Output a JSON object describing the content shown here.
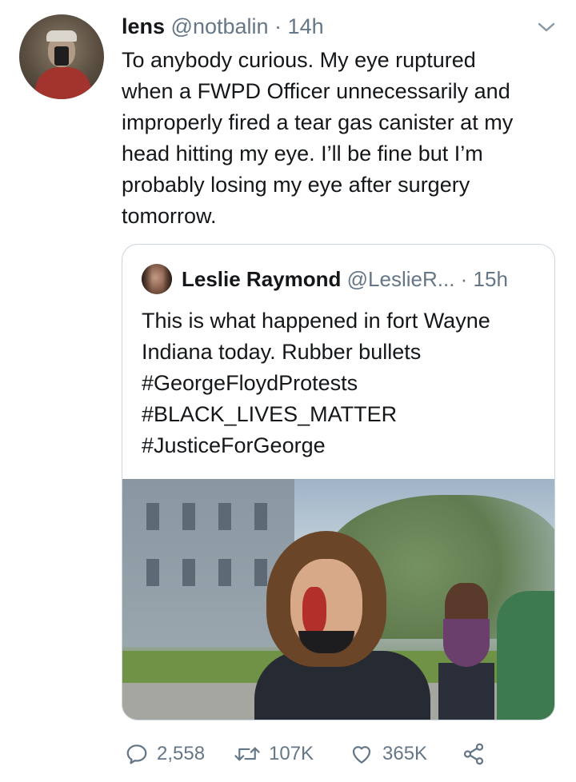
{
  "tweet": {
    "author_name": "lens",
    "author_handle": "@notbalin",
    "separator": " · ",
    "time": "14h",
    "text": "To anybody curious. My eye ruptured\nwhen a FWPD Officer unnecessarily and\nimproperly fired a tear gas canister at my\nhead hitting my eye. I’ll be fine but I’m\nprobably losing my eye after surgery\ntomorrow."
  },
  "quoted": {
    "author_name": "Leslie Raymond",
    "author_handle": "@LeslieR...",
    "separator": " · ",
    "time": "15h",
    "text": "This is what happened in fort Wayne\nIndiana today. Rubber bullets\n#GeorgeFloydProtests\n#BLACK_LIVES_MATTER\n#JusticeForGeorge"
  },
  "actions": {
    "replies": "2,558",
    "retweets": "107K",
    "likes": "365K"
  },
  "icons": {
    "menu": "chevron-down-icon",
    "reply": "reply-icon",
    "retweet": "retweet-icon",
    "like": "heart-icon",
    "share": "share-icon"
  },
  "colors": {
    "text": "#14171a",
    "secondary": "#657786",
    "border": "#ccd6dd"
  }
}
